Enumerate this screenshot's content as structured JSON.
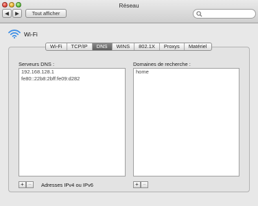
{
  "window": {
    "title": "Réseau"
  },
  "toolbar": {
    "back_glyph": "◀",
    "forward_glyph": "▶",
    "show_all_label": "Tout afficher",
    "search_placeholder": "",
    "search_icon": "search-icon"
  },
  "header": {
    "interface_icon": "wifi-icon",
    "interface_name": "Wi-Fi"
  },
  "tabs": [
    {
      "label": "Wi-Fi",
      "active": false
    },
    {
      "label": "TCP/IP",
      "active": false
    },
    {
      "label": "DNS",
      "active": true
    },
    {
      "label": "WINS",
      "active": false
    },
    {
      "label": "802.1X",
      "active": false
    },
    {
      "label": "Proxys",
      "active": false
    },
    {
      "label": "Matériel",
      "active": false
    }
  ],
  "dns": {
    "label": "Serveurs DNS :",
    "servers": [
      "192.168.128.1",
      "fe80::22b8:2bff:fe09:d282"
    ]
  },
  "search_domains": {
    "label": "Domaines de recherche :",
    "domains": [
      "home"
    ]
  },
  "footer": {
    "add_glyph": "+",
    "remove_glyph": "−",
    "address_format": "Adresses IPv4 ou IPv6"
  },
  "colors": {
    "active_tab": "#6b6b6b",
    "wifi_icon": "#3b8ee6",
    "pane": "#e3e3e3"
  }
}
